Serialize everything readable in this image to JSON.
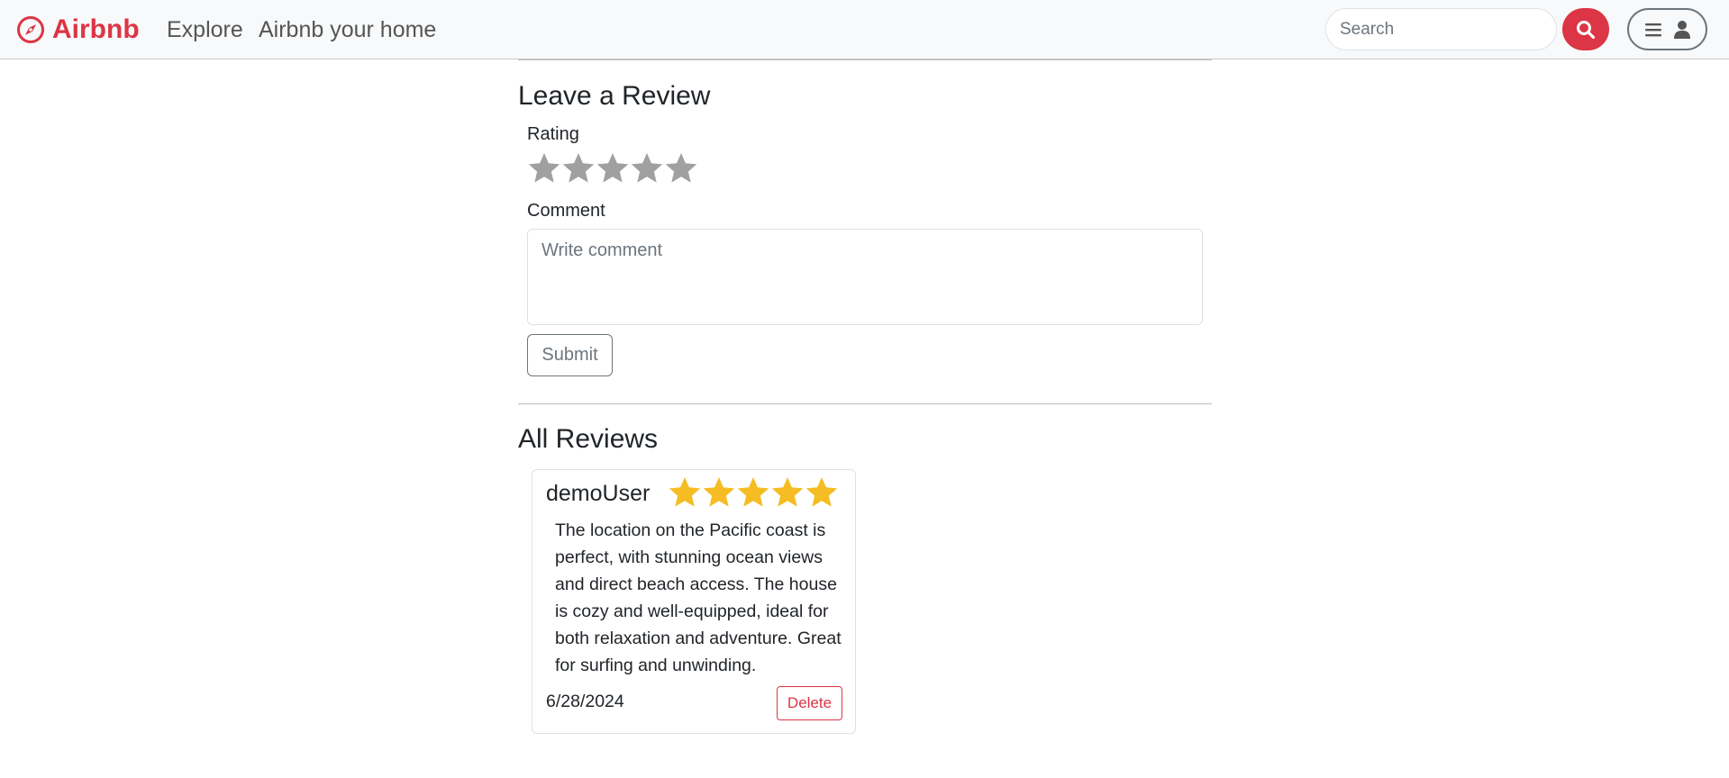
{
  "nav": {
    "brand": "Airbnb",
    "brand_color": "#dc3545",
    "links": [
      "Explore",
      "Airbnb your home"
    ],
    "search_placeholder": "Search",
    "search_icon": "magnifier-icon",
    "menu_icon": "hamburger-icon",
    "user_icon": "user-icon"
  },
  "leave_review": {
    "title": "Leave a Review",
    "rating_label": "Rating",
    "rating_value": 0,
    "rating_max": 5,
    "comment_label": "Comment",
    "comment_placeholder": "Write comment",
    "submit_label": "Submit"
  },
  "all_reviews": {
    "title": "All Reviews",
    "reviews": [
      {
        "author": "demoUser",
        "rating": 5,
        "text": "The location on the Pacific coast is perfect, with stunning ocean views and direct beach access. The house is cozy and well-equipped, ideal for both relaxation and adventure. Great for surfing and unwinding.",
        "date": "6/28/2024",
        "delete_label": "Delete"
      }
    ]
  },
  "colors": {
    "star_filled": "#f5bd23",
    "star_empty": "#a0a0a0",
    "danger": "#dc3545"
  }
}
